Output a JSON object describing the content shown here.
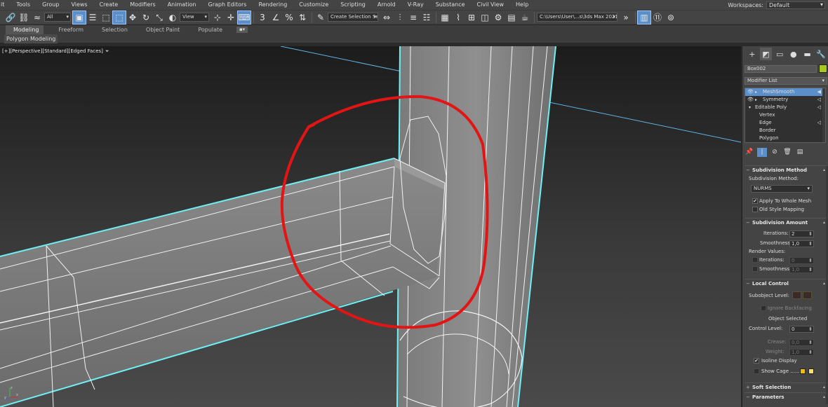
{
  "menubar": {
    "items": [
      "it",
      "Tools",
      "Group",
      "Views",
      "Create",
      "Modifiers",
      "Animation",
      "Graph Editors",
      "Rendering",
      "Customize",
      "Scripting",
      "Arnold",
      "V-Ray",
      "Substance",
      "Civil View",
      "Help"
    ],
    "workspaces_label": "Workspaces:",
    "workspaces_value": "Default"
  },
  "toolbar": {
    "selection_filter": "All",
    "ref_coord": "View",
    "named_selection": "Create Selection Se",
    "project_path": "C:\\Users\\User\\...s\\3ds Max 2021"
  },
  "ribbon": {
    "tabs": [
      "Modeling",
      "Freeform",
      "Selection",
      "Object Paint",
      "Populate"
    ],
    "active_tab": "Modeling",
    "sub_label": "Polygon Modeling"
  },
  "viewport": {
    "label_parts": [
      "[+]",
      "[Perspective]",
      "[Standard]",
      "[Edged Faces]"
    ],
    "axis_labels": {
      "x": "x",
      "y": "y",
      "z": "z"
    }
  },
  "command_panel": {
    "object_name": "Box002",
    "object_color": "#a9c81e",
    "modifier_list_label": "Modifier List",
    "stack": [
      {
        "label": "MeshSmooth",
        "selected": true,
        "eye": true,
        "expand": true,
        "level": 0
      },
      {
        "label": "Symmetry",
        "selected": false,
        "eye": true,
        "expand": true,
        "level": 0
      },
      {
        "label": "Editable Poly",
        "selected": false,
        "eye": false,
        "expand": true,
        "level": 0
      },
      {
        "label": "Vertex",
        "selected": false,
        "eye": false,
        "expand": false,
        "level": 1
      },
      {
        "label": "Edge",
        "selected": false,
        "eye": false,
        "expand": false,
        "level": 1
      },
      {
        "label": "Border",
        "selected": false,
        "eye": false,
        "expand": false,
        "level": 1
      },
      {
        "label": "Polygon",
        "selected": false,
        "eye": false,
        "expand": false,
        "level": 1
      }
    ],
    "subdivision_method": {
      "title": "Subdivision Method",
      "method_label": "Subdivision Method:",
      "method_value": "NURMS",
      "apply_whole_mesh": "Apply To Whole Mesh",
      "apply_whole_mesh_checked": true,
      "old_style_mapping": "Old Style Mapping",
      "old_style_mapping_checked": false
    },
    "subdivision_amount": {
      "title": "Subdivision Amount",
      "iterations_label": "Iterations:",
      "iterations_value": "2",
      "smoothness_label": "Smoothness:",
      "smoothness_value": "1,0",
      "render_values_label": "Render Values:",
      "render_iterations_label": "Iterations:",
      "render_iterations_value": "0",
      "render_smoothness_label": "Smoothness:",
      "render_smoothness_value": "1,0"
    },
    "local_control": {
      "title": "Local Control",
      "subobject_label": "Subobject Level:",
      "ignore_backfacing": "Ignore Backfacing",
      "object_selected": "Object Selected",
      "control_level_label": "Control Level:",
      "control_level_value": "0",
      "crease_label": "Crease:",
      "crease_value": "0,0",
      "weight_label": "Weight:",
      "weight_value": "1,0",
      "isoline_display": "Isoline Display",
      "isoline_checked": true,
      "show_cage": "Show Cage ......",
      "cage_color_1": "#f0c000",
      "cage_color_2": "#f5e07a"
    },
    "soft_selection": {
      "title": "Soft Selection"
    },
    "parameters": {
      "title": "Parameters"
    }
  }
}
